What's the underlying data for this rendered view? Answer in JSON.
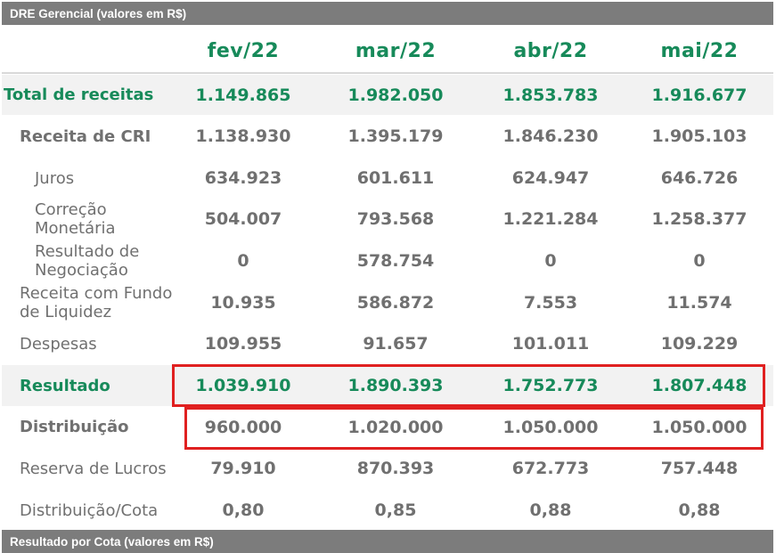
{
  "top_bar": "DRE Gerencial (valores em R$)",
  "bottom_bar": "Resultado por Cota (valores em R$)",
  "columns": [
    "fev/22",
    "mar/22",
    "abr/22",
    "mai/22"
  ],
  "rows": [
    {
      "label": "Total de receitas",
      "values": [
        "1.149.865",
        "1.982.050",
        "1.853.783",
        "1.916.677"
      ]
    },
    {
      "label": "Receita de CRI",
      "values": [
        "1.138.930",
        "1.395.179",
        "1.846.230",
        "1.905.103"
      ]
    },
    {
      "label": "Juros",
      "values": [
        "634.923",
        "601.611",
        "624.947",
        "646.726"
      ]
    },
    {
      "label": "Correção\nMonetária",
      "values": [
        "504.007",
        "793.568",
        "1.221.284",
        "1.258.377"
      ]
    },
    {
      "label": "Resultado de\nNegociação",
      "values": [
        "0",
        "578.754",
        "0",
        "0"
      ]
    },
    {
      "label": "Receita com Fundo\nde Liquidez",
      "values": [
        "10.935",
        "586.872",
        "7.553",
        "11.574"
      ]
    },
    {
      "label": "Despesas",
      "values": [
        "109.955",
        "91.657",
        "101.011",
        "109.229"
      ]
    },
    {
      "label": "Resultado",
      "values": [
        "1.039.910",
        "1.890.393",
        "1.752.773",
        "1.807.448"
      ]
    },
    {
      "label": "Distribuição",
      "values": [
        "960.000",
        "1.020.000",
        "1.050.000",
        "1.050.000"
      ]
    },
    {
      "label": "Reserva de Lucros",
      "values": [
        "79.910",
        "870.393",
        "672.773",
        "757.448"
      ]
    },
    {
      "label": "Distribuição/Cota",
      "values": [
        "0,80",
        "0,85",
        "0,88",
        "0,88"
      ]
    }
  ],
  "colors": {
    "accent_green": "#178a5a",
    "text_gray": "#707070",
    "bar_gray": "#7c7c7c",
    "highlight_red": "#e02020",
    "shade": "#f2f2f2"
  }
}
